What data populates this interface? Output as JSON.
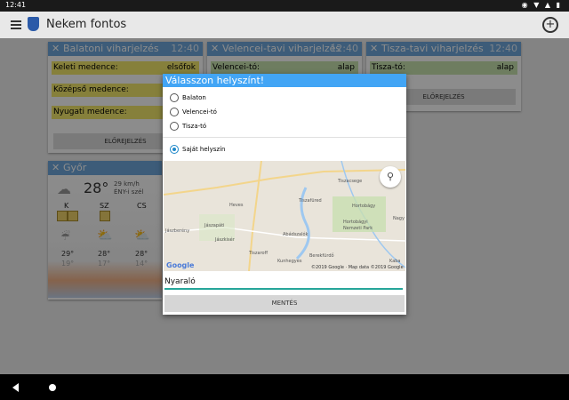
{
  "status": {
    "time": "12:41",
    "icons": "◉ ▼ ▲ ▮"
  },
  "app": {
    "title": "Nekem fontos",
    "add": "+"
  },
  "cards": {
    "balaton": {
      "title": "Balatoni viharjelzés",
      "time": "12:40",
      "rows": [
        {
          "label": "Keleti medence:",
          "value": "elsőfok"
        },
        {
          "label": "Középső medence:",
          "value": ""
        },
        {
          "label": "Nyugati medence:",
          "value": ""
        }
      ],
      "button": "ELŐREJELZÉS"
    },
    "velence": {
      "title": "Velencei-tavi viharjelzés",
      "time": "12:40",
      "rows": [
        {
          "label": "Velencei-tó:",
          "value": "alap"
        }
      ]
    },
    "tisza": {
      "title": "Tisza-tavi viharjelzés",
      "time": "12:40",
      "rows": [
        {
          "label": "Tisza-tó:",
          "value": "alap"
        }
      ],
      "button": "ELŐREJELZÉS"
    },
    "gyor": {
      "title": "Győr",
      "temp": "28°",
      "wind": "29 km/h",
      "wind_dir": "ÉNY-i szél",
      "days": [
        {
          "day": "K",
          "hi": "29°",
          "lo": "19°"
        },
        {
          "day": "SZ",
          "hi": "28°",
          "lo": "17°"
        },
        {
          "day": "CS",
          "hi": "28°",
          "lo": "14°"
        }
      ]
    }
  },
  "dialog": {
    "title": "Válasszon helyszínt!",
    "options": [
      "Balaton",
      "Velencei-tó",
      "Tisza-tó"
    ],
    "own_location": "Saját helyszín",
    "map": {
      "labels": [
        "Tiszacsege",
        "Heves",
        "Tiszafüred",
        "Hortobágy",
        "Hortobágyi",
        "Nemzeti Park",
        "Jászapáti",
        "Jászberény",
        "Jászkisér",
        "Abádszalók",
        "Tiszaroff",
        "Kunhegyes",
        "Berekfürdő",
        "Kaba",
        "Nagy"
      ],
      "copyright": "©2019 Google · Map data ©2019 Google",
      "logo": "Google"
    },
    "name_value": "Nyaraló",
    "save": "MENTÉS"
  }
}
